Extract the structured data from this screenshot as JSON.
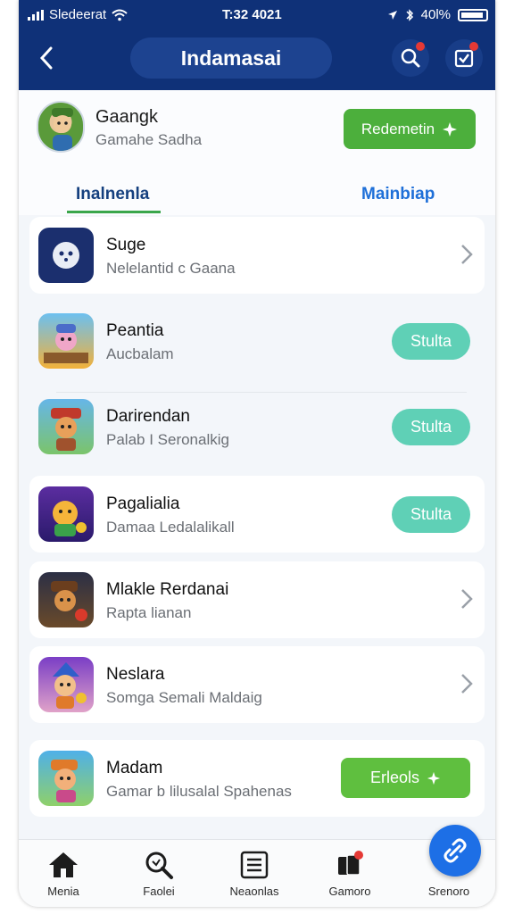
{
  "status_bar": {
    "carrier": "Sledeerat",
    "time": "T:32 4021",
    "battery": "40l%"
  },
  "header": {
    "title": "Indamasai",
    "back_icon": "back-chevron-icon",
    "search_icon": "search-icon",
    "checklist_icon": "checklist-icon"
  },
  "profile": {
    "name": "Gaangk",
    "subtitle": "Gamahe Sadha",
    "redeem_label": "Redemetin"
  },
  "tabs": [
    {
      "label": "Inalnenla",
      "active": true
    },
    {
      "label": "Mainbiap",
      "active": false
    }
  ],
  "list": [
    {
      "name": "Suge",
      "sub": "Nelelantid c Gaana",
      "action": "chevron"
    },
    {
      "name": "Peantia",
      "sub": "Aucbalam",
      "action": "pill",
      "button": "Stulta"
    },
    {
      "name": "Darirendan",
      "sub": "Palab I Seronalkig",
      "action": "pill",
      "button": "Stulta"
    },
    {
      "name": "Pagalialia",
      "sub": "Damaa Ledalalikall",
      "action": "pill",
      "button": "Stulta"
    },
    {
      "name": "Mlakle Rerdanai",
      "sub": "Rapta lianan",
      "action": "chevron"
    },
    {
      "name": "Neslara",
      "sub": "Somga Semali Maldaig",
      "action": "chevron"
    },
    {
      "name": "Madam",
      "sub": "Gamar b lilusalal Spahenas",
      "action": "green",
      "button": "Erleols"
    }
  ],
  "bottom_nav": [
    {
      "label": "Menia",
      "icon": "home-icon"
    },
    {
      "label": "Faolei",
      "icon": "search-icon"
    },
    {
      "label": "Neaonlas",
      "icon": "list-icon"
    },
    {
      "label": "Gamoro",
      "icon": "cards-icon"
    },
    {
      "label": "Srenoro",
      "icon": "link-icon"
    }
  ],
  "colors": {
    "header": "#0f3178",
    "accent_green": "#4caf3c",
    "teal_button": "#5fd0b6",
    "fab": "#1d6fe6",
    "badge_red": "#e53935"
  }
}
